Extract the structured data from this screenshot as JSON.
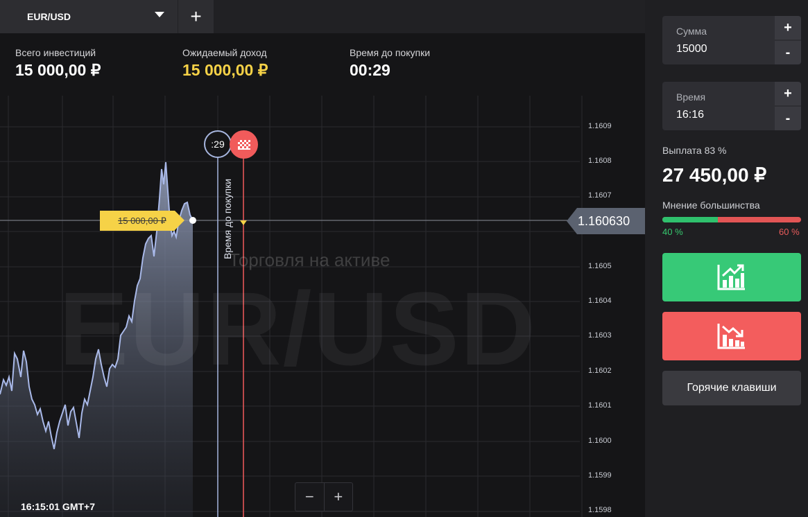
{
  "topbar": {
    "asset_tab_label": "EUR/USD",
    "add_tab_label": "+"
  },
  "stats": {
    "total_investment": {
      "label": "Всего инвестиций",
      "value": "15 000,00 ₽"
    },
    "expected_income": {
      "label": "Ожидаемый доход",
      "value": "15 000,00 ₽"
    },
    "time_to_purchase": {
      "label": "Время до покупки",
      "value": "00:29"
    }
  },
  "chart": {
    "watermark": "EUR/USD",
    "watermark_sub": "Торговля на активе",
    "timer": ":29",
    "purchase_line_label": "Время до покупки",
    "investment_tag": "15 000,00 ₽",
    "current_price": "1.160630",
    "y_ticks": [
      "1.1609",
      "1.1608",
      "1.1607",
      "1.1605",
      "1.1604",
      "1.1603",
      "1.1602",
      "1.1601",
      "1.1600",
      "1.1599",
      "1.1598"
    ],
    "time_label": "16:15:01 GMT+7",
    "zoom_minus": "−",
    "zoom_plus": "+",
    "colors": {
      "line": "#a9b9e9",
      "price_tag": "#5b6270",
      "investment_tag": "#f6d247",
      "expiry_line": "#f15b5b"
    }
  },
  "panel": {
    "amount": {
      "label": "Сумма",
      "value": "15000"
    },
    "time": {
      "label": "Время",
      "value": "16:16"
    },
    "plus": "+",
    "minus": "-",
    "payout": {
      "label": "Выплата",
      "percent": "83 %",
      "value": "27 450,00 ₽"
    },
    "majority": {
      "label": "Мнение большинства",
      "up_percent": "40 %",
      "down_percent": "60 %",
      "up_fraction": 0.4
    },
    "buttons": {
      "up_icon": "chart-up-icon",
      "down_icon": "chart-down-icon",
      "hotkeys_label": "Горячие клавиши"
    },
    "colors": {
      "up": "#37c977",
      "down": "#f35d5d"
    }
  }
}
